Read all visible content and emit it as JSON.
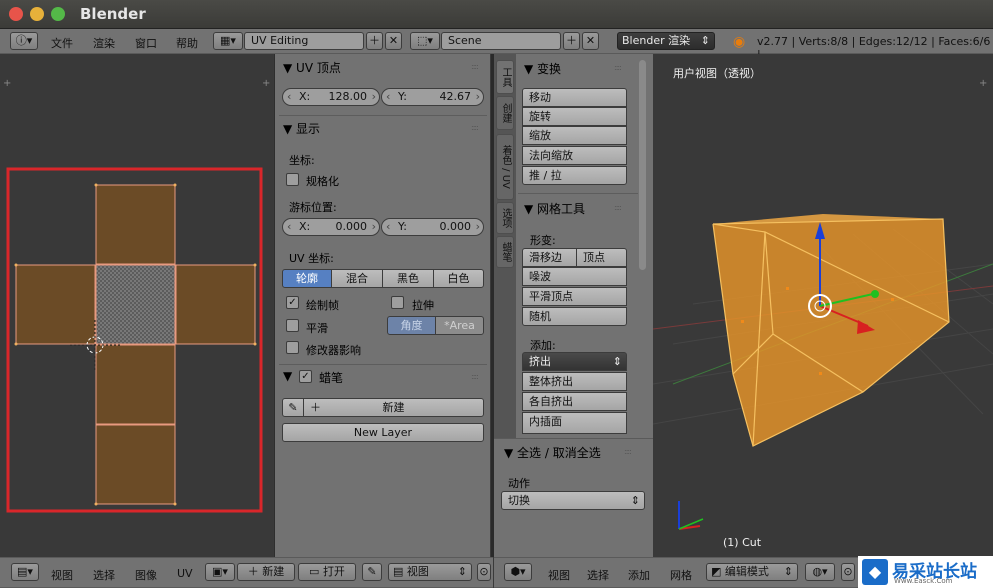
{
  "window": {
    "title": "Blender"
  },
  "info_header": {
    "menus": [
      "文件",
      "渲染",
      "窗口",
      "帮助"
    ],
    "layout": "UV Editing",
    "scene": "Scene",
    "engine": "Blender 渲染",
    "stats": "v2.77 | Verts:8/8 | Edges:12/12 | Faces:6/6 |"
  },
  "uv_properties": {
    "uv_vertex_title": "UV 顶点",
    "x_label": "X:",
    "x_value": "128.00",
    "y_label": "Y:",
    "y_value": "42.67",
    "display_title": "显示",
    "coords_label": "坐标:",
    "normalized": "规格化",
    "cursor_label": "游标位置:",
    "cursor_x_label": "X:",
    "cursor_x": "0.000",
    "cursor_y_label": "Y:",
    "cursor_y": "0.000",
    "uv_coords_label": "UV 坐标:",
    "draw_types": [
      "轮廓",
      "混合",
      "黑色",
      "白色"
    ],
    "draw_frame": "绘制帧",
    "stretch": "拉伸",
    "smooth": "平滑",
    "angle": "角度",
    "area": "*Area",
    "modifier_effect": "修改器影响",
    "grease_title": "蜡笔",
    "new_btn": "新建",
    "new_layer_btn": "New Layer"
  },
  "tool_tabs": [
    "工具",
    "创建",
    "着色 / UV",
    "选项",
    "蜡笔"
  ],
  "tools": {
    "transform_title": "变换",
    "transform_items": [
      "移动",
      "旋转",
      "缩放",
      "法向缩放",
      "推 / 拉"
    ],
    "mesh_title": "网格工具",
    "deform_label": "形变:",
    "slide_edge": "滑移边",
    "slide_vertex": "顶点",
    "deform_items": [
      "噪波",
      "平滑顶点",
      "随机"
    ],
    "add_label": "添加:",
    "extrude": "挤出",
    "add_items": [
      "整体挤出",
      "各自挤出",
      "内插面"
    ],
    "select_title": "全选 / 取消全选",
    "action_label": "动作",
    "action_value": "切换"
  },
  "viewport": {
    "label": "用户视图（透视）",
    "object_label": "(1) Cut"
  },
  "uv_footer": {
    "menus": [
      "视图",
      "选择",
      "图像",
      "UV"
    ],
    "new": "新建",
    "open": "打开",
    "view": "视图"
  },
  "view3d_footer": {
    "menus": [
      "视图",
      "选择",
      "添加",
      "网格"
    ],
    "mode": "编辑模式"
  },
  "watermark": {
    "text": "易采站长站",
    "sub": "Www.Easck.Com"
  },
  "colors": {
    "face": "#6b4b26",
    "selected_edge": "#e8a33a",
    "highlight": "#d9262a",
    "blue_btn": "#5680c2"
  }
}
